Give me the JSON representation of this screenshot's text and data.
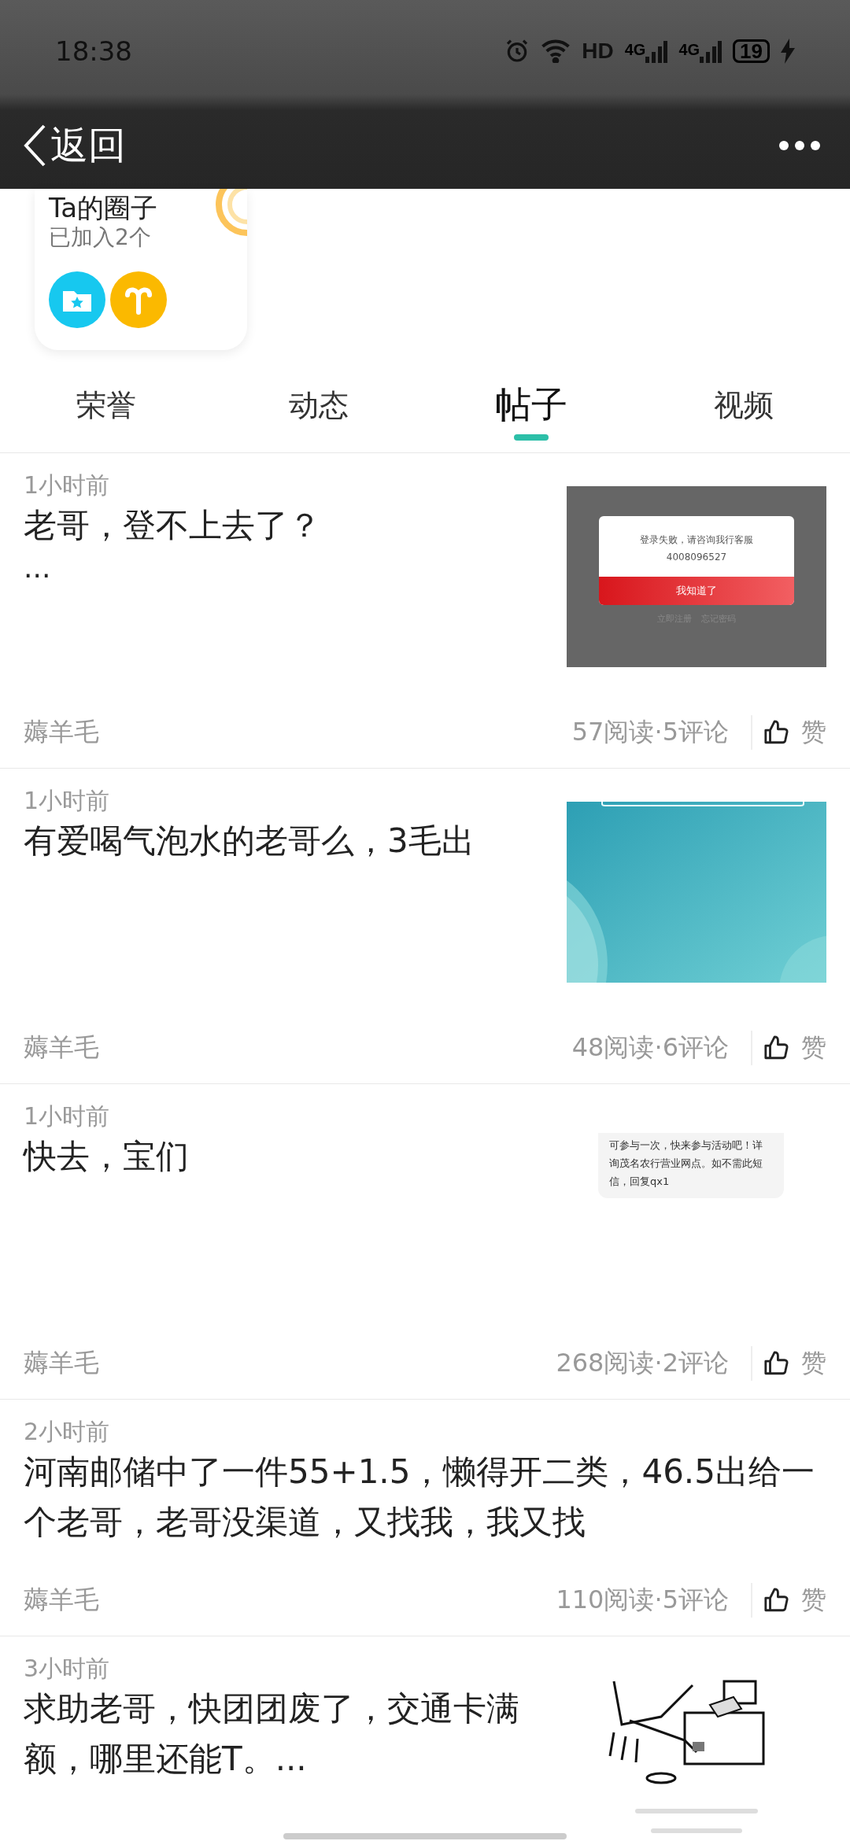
{
  "status_bar": {
    "time": "18:38",
    "hd": "HD",
    "signals": [
      "4G",
      "4G"
    ],
    "battery": "19"
  },
  "header": {
    "back": "返回"
  },
  "circle_card": {
    "title": "Ta的圈子",
    "subtitle": "已加入2个"
  },
  "tabs": [
    {
      "label": "荣誉",
      "selected": false
    },
    {
      "label": "动态",
      "selected": false
    },
    {
      "label": "帖子",
      "selected": true
    },
    {
      "label": "视频",
      "selected": false
    }
  ],
  "posts": [
    {
      "time": "1小时前",
      "title": "老哥，登不上去了？",
      "body": "...",
      "author": "薅羊毛",
      "stats": "57阅读·5评论",
      "like": "赞",
      "image": {
        "kind": "dialog",
        "message": "登录失败，请咨询我行客服",
        "phone": "4008096527",
        "button": "我知道了",
        "links": [
          "立即注册",
          "忘记密码"
        ]
      }
    },
    {
      "time": "1小时前",
      "title": "有爱喝气泡水的老哥么，3毛出",
      "author": "薅羊毛",
      "stats": "48阅读·6评论",
      "like": "赞"
    },
    {
      "time": "1小时前",
      "title": "快去，宝们",
      "author": "薅羊毛",
      "stats": "268阅读·2评论",
      "like": "赞",
      "image": {
        "kind": "sms",
        "lines": [
          "可参与一次，快来参与活动吧！详",
          "询茂名农行营业网点。如不需此短",
          "信，回复qx1"
        ]
      }
    },
    {
      "time": "2小时前",
      "title": "河南邮储中了一件55+1.5，懒得开二类，46.5出给一个老哥，老哥没渠道，又找我，我又找",
      "author": "薅羊毛",
      "stats": "110阅读·5评论",
      "like": "赞"
    },
    {
      "time": "3小时前",
      "title": "求助老哥，快团团废了，交通卡满额，哪里还能T。...",
      "image": {
        "kind": "cartoon"
      }
    }
  ]
}
